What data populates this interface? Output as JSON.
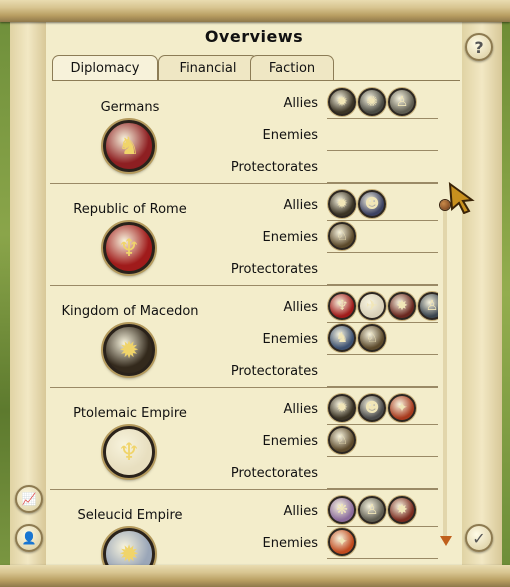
{
  "window": {
    "title": "Overviews"
  },
  "tabs": [
    {
      "label": "Diplomacy",
      "active": true
    },
    {
      "label": "Financial",
      "active": false
    },
    {
      "label": "Faction",
      "active": false
    }
  ],
  "row_labels": {
    "allies": "Allies",
    "enemies": "Enemies",
    "protectorates": "Protectorates"
  },
  "factions": [
    {
      "name": "Germans",
      "emblem": "boar-icon",
      "color": "#8e1f22",
      "allies": [
        {
          "icon": "sun-icon",
          "color": "#3b3425"
        },
        {
          "icon": "wolf-icon",
          "color": "#4a4a42"
        },
        {
          "icon": "warrior-icon",
          "color": "#5e5c50"
        }
      ],
      "enemies": [],
      "protectorates": []
    },
    {
      "name": "Republic of Rome",
      "emblem": "eagle-icon",
      "color": "#a01b1b",
      "allies": [
        {
          "icon": "sun-icon",
          "color": "#3b3425"
        },
        {
          "icon": "head-icon",
          "color": "#3c4262"
        }
      ],
      "enemies": [
        {
          "icon": "rider-icon",
          "color": "#5c4a2c"
        }
      ],
      "protectorates": []
    },
    {
      "name": "Kingdom of Macedon",
      "emblem": "sun-icon",
      "color": "#33291c",
      "allies": [
        {
          "icon": "eagle-icon",
          "color": "#a01b1b"
        },
        {
          "icon": "bird-icon",
          "color": "#d8d0b8"
        },
        {
          "icon": "griffin-icon",
          "color": "#6a2820"
        },
        {
          "icon": "warrior-icon",
          "color": "#3b4650"
        }
      ],
      "enemies": [
        {
          "icon": "horse-icon",
          "color": "#3c5070"
        },
        {
          "icon": "rider-icon",
          "color": "#5c4a2c"
        }
      ],
      "protectorates": []
    },
    {
      "name": "Ptolemaic Empire",
      "emblem": "eagle-icon",
      "color": "#e8dfc0",
      "allies": [
        {
          "icon": "sun-icon",
          "color": "#3b3425"
        },
        {
          "icon": "head-icon",
          "color": "#4a4a4a"
        },
        {
          "icon": "star-icon",
          "color": "#a73a1e"
        }
      ],
      "enemies": [
        {
          "icon": "rider-icon",
          "color": "#5c4a2c"
        }
      ],
      "protectorates": []
    },
    {
      "name": "Seleucid Empire",
      "emblem": "sun-icon",
      "color": "#9aa6b8",
      "allies": [
        {
          "icon": "lion-icon",
          "color": "#8a6a9a"
        },
        {
          "icon": "warrior-icon",
          "color": "#5e5c50"
        },
        {
          "icon": "griffin-icon",
          "color": "#7a2c20"
        }
      ],
      "enemies": [
        {
          "icon": "star-icon",
          "color": "#c04a1e"
        }
      ],
      "protectorates": []
    }
  ],
  "buttons": {
    "help": "?",
    "confirm": "✓",
    "stats": "📈",
    "advisor": "👤"
  }
}
